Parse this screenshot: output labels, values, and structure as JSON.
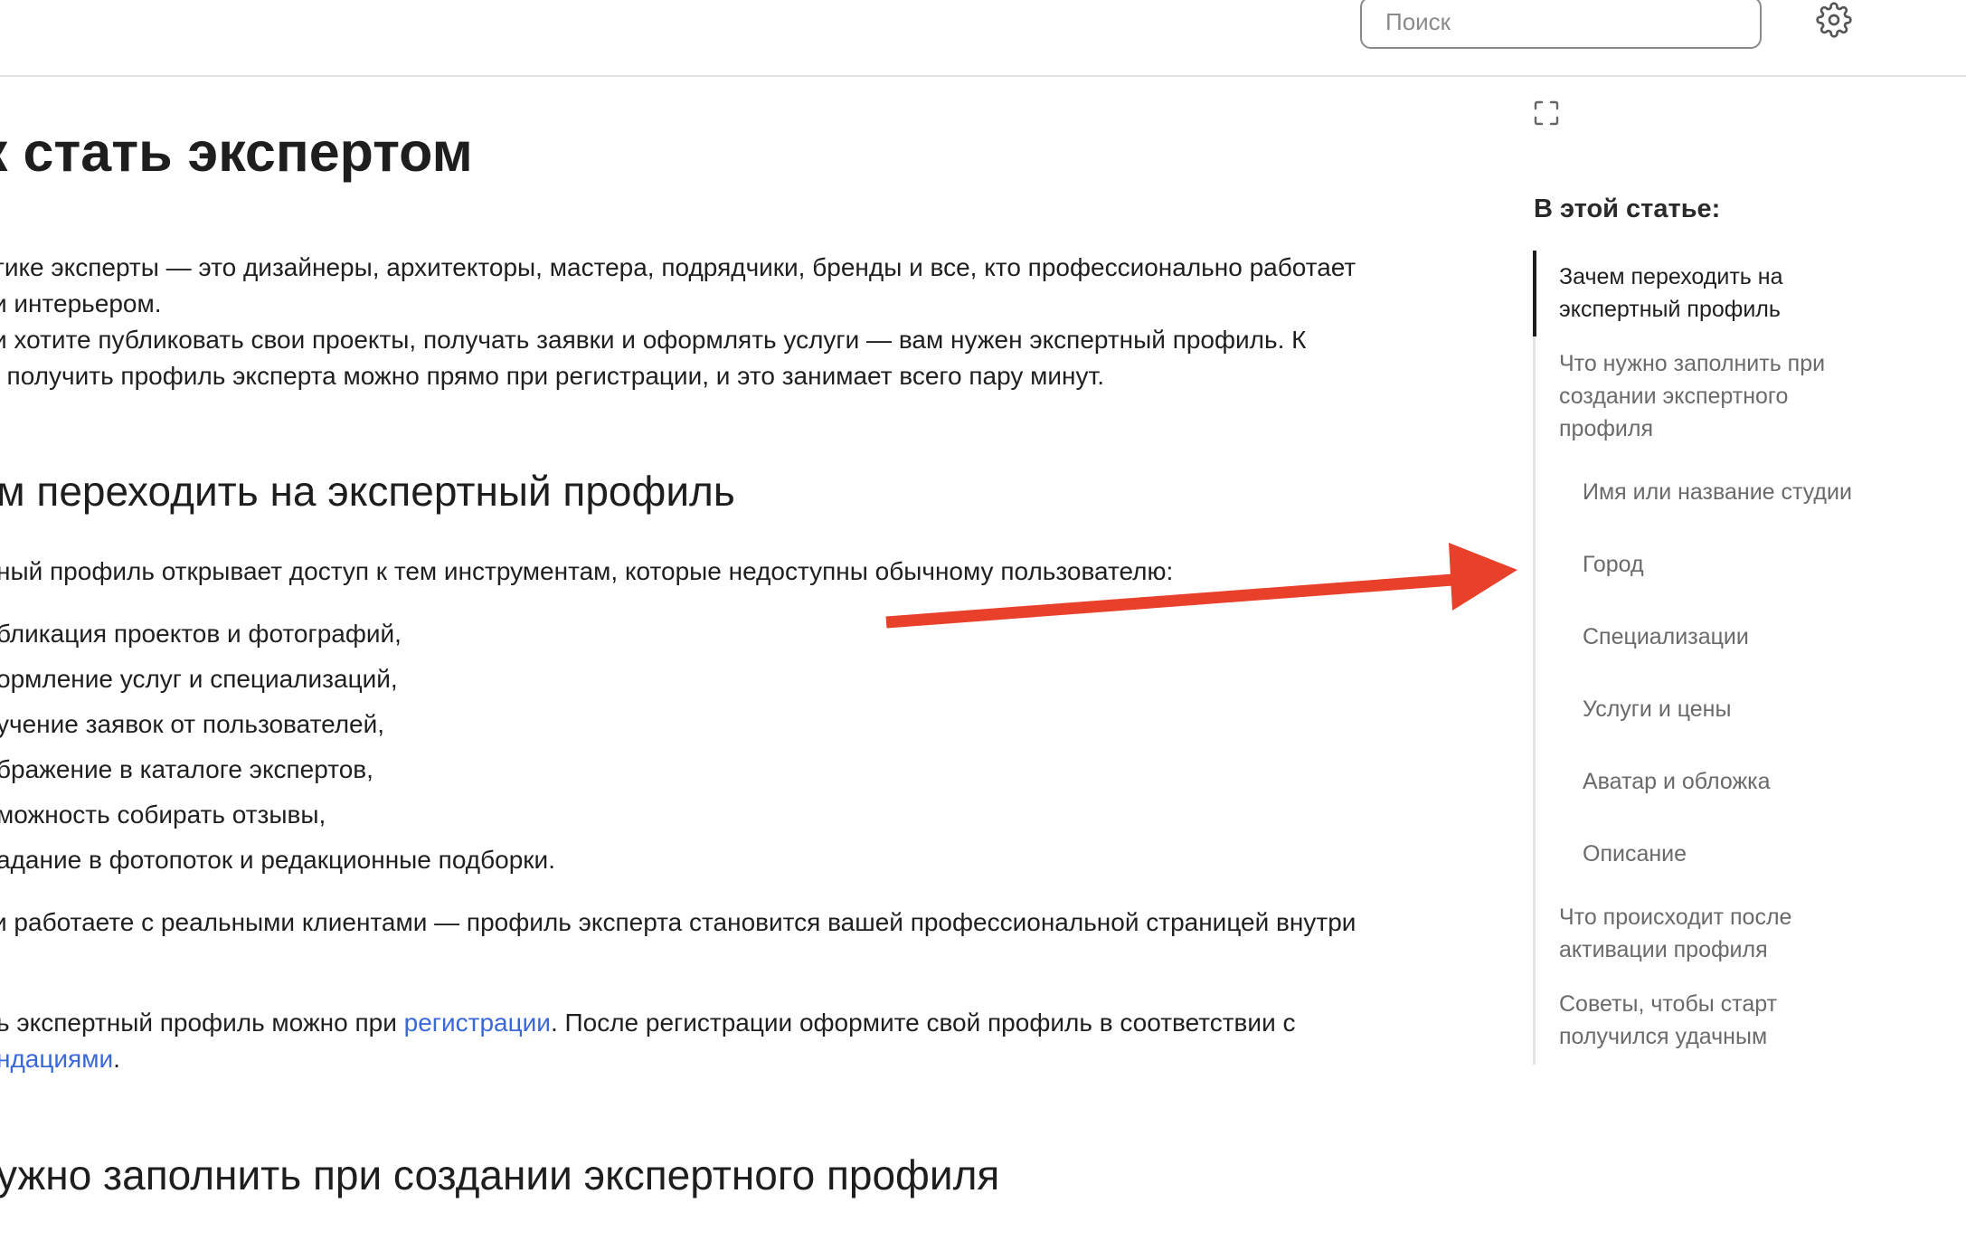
{
  "header": {
    "search_placeholder": "Поиск",
    "settings_icon": "gear-icon"
  },
  "article": {
    "title": "к стать экспертом",
    "intro": [
      "тике эксперты — это дизайнеры, архитекторы, мастера, подрядчики, бренды и все, кто профессионально работает",
      "и интерьером.",
      "и хотите публиковать свои проекты, получать заявки и оформлять услуги — вам нужен экспертный профиль. К",
      ", получить профиль эксперта можно прямо при регистрации, и это занимает всего пару минут."
    ],
    "section1_title": "м переходить на экспертный профиль",
    "section1_lead": "ный профиль открывает доступ к тем инструментам, которые недоступны обычному пользователю:",
    "section1_list": [
      "бликация проектов и фотографий,",
      "ормление услуг и специализаций,",
      "учение заявок от пользователей,",
      "бражение в каталоге экспертов,",
      "можность собирать отзывы,",
      "адание в фотопоток и редакционные подборки."
    ],
    "section1_para": [
      "и работаете с реальными клиентами — профиль эксперта становится вашей профессиональной страницей внутри",
      "."
    ],
    "section1_reg": {
      "before": "ь экспертный профиль можно при ",
      "link1": "регистрации",
      "after": ". После регистрации оформите свой профиль в соответствии с",
      "link2": "ндациями",
      "end": "."
    },
    "section2_title": "ужно заполнить при создании экспертного профиля"
  },
  "toc": {
    "expand_icon": "expand-icon",
    "heading": "В этой статье:",
    "items": [
      {
        "label": "Зачем переходить на экспертный профиль",
        "active": true
      },
      {
        "label": "Что нужно заполнить при создании экспертного профиля"
      },
      {
        "label": "Имя или название студии",
        "sub": true
      },
      {
        "label": "Город",
        "sub": true
      },
      {
        "label": "Специализации",
        "sub": true
      },
      {
        "label": "Услуги и цены",
        "sub": true
      },
      {
        "label": "Аватар и обложка",
        "sub": true
      },
      {
        "label": "Описание",
        "sub": true
      },
      {
        "label": "Что происходит после активации профиля"
      },
      {
        "label": "Советы, чтобы старт получился удачным"
      }
    ]
  },
  "annotation": {
    "arrow_color": "#e8402a"
  }
}
